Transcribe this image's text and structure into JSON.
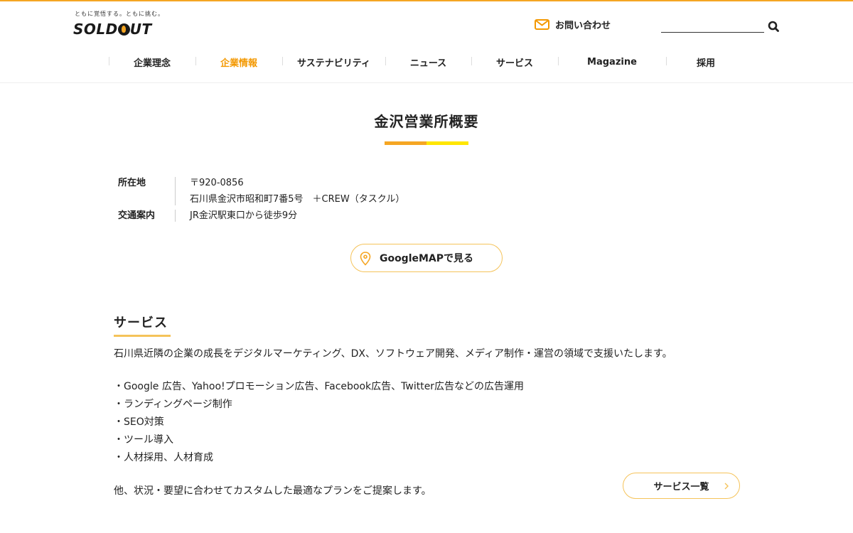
{
  "header": {
    "logo_tagline": "ともに覚悟する。ともに挑む。",
    "logo_text_left": "SOLD",
    "logo_text_right": "UT",
    "contact_label": "お問い合わせ",
    "search_placeholder": "",
    "accent_color": "#f39800"
  },
  "nav": {
    "items": [
      {
        "label": "企業理念"
      },
      {
        "label": "企業情報",
        "active": true
      },
      {
        "label": "サステナビリティ"
      },
      {
        "label": "ニュース"
      },
      {
        "label": "サービス"
      },
      {
        "label": "Magazine"
      },
      {
        "label": "採用"
      }
    ]
  },
  "page": {
    "title": "金沢営業所概要"
  },
  "info": {
    "address_label": "所在地",
    "postal_code": "〒920-0856",
    "address": "石川県金沢市昭和町7番5号　＋CREW（タスクル）",
    "access_label": "交通案内",
    "access": "JR金沢駅東口から徒歩9分"
  },
  "map_button": {
    "label": "GoogleMAPで見る",
    "icon": "map-pin-icon"
  },
  "services": {
    "heading": "サービス",
    "intro": "石川県近隣の企業の成長をデジタルマーケティング、DX、ソフトウェア開発、メディア制作・運営の領域で支援いたします。",
    "items": [
      "・Google 広告、Yahoo!プロモーション広告、Facebook広告、Twitter広告などの広告運用",
      "・ランディングページ制作",
      "・SEO対策",
      "・ツール導入",
      "・人材採用、人材育成"
    ],
    "outro": "他、状況・要望に合わせてカスタムした最適なプランをご提案します。",
    "list_button": "サービス一覧"
  }
}
